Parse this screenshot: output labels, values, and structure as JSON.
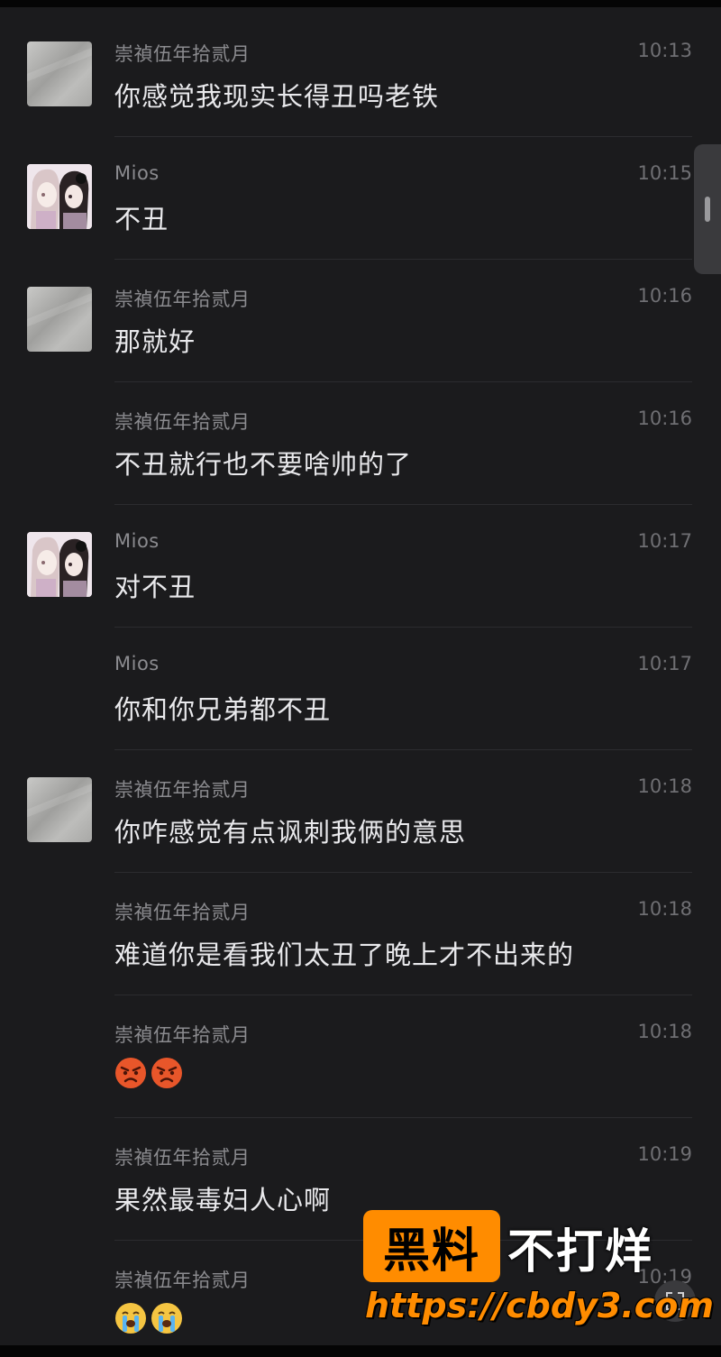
{
  "colors": {
    "background": "#1b1b1d",
    "name_text": "#8b8b8f",
    "time_text": "#6f6f73",
    "message_text": "#e9e9ec",
    "divider": "#2c2c2f",
    "watermark_accent": "#ff8c00"
  },
  "messages": [
    {
      "sender": "崇禎伍年拾贰月",
      "time": "10:13",
      "text": "你感觉我现实长得丑吗老铁",
      "avatar": "gray-avatar"
    },
    {
      "sender": "Mios",
      "time": "10:15",
      "text": "不丑",
      "avatar": "anime-girl-avatar"
    },
    {
      "sender": "崇禎伍年拾贰月",
      "time": "10:16",
      "text": "那就好",
      "avatar": "gray-avatar"
    },
    {
      "sender": "崇禎伍年拾贰月",
      "time": "10:16",
      "text": "不丑就行也不要啥帅的了"
    },
    {
      "sender": "Mios",
      "time": "10:17",
      "text": "对不丑",
      "avatar": "anime-girl-avatar"
    },
    {
      "sender": "Mios",
      "time": "10:17",
      "text": "你和你兄弟都不丑"
    },
    {
      "sender": "崇禎伍年拾贰月",
      "time": "10:18",
      "text": "你咋感觉有点讽刺我俩的意思",
      "avatar": "gray-avatar"
    },
    {
      "sender": "崇禎伍年拾贰月",
      "time": "10:18",
      "text": "难道你是看我们太丑了晚上才不出来的"
    },
    {
      "sender": "崇禎伍年拾贰月",
      "time": "10:18",
      "emojis": [
        "angry-face-icon",
        "angry-face-icon"
      ]
    },
    {
      "sender": "崇禎伍年拾贰月",
      "time": "10:19",
      "text": "果然最毒妇人心啊"
    },
    {
      "sender": "崇禎伍年拾贰月",
      "time": "10:19",
      "emojis": [
        "crying-face-icon",
        "crying-face-icon"
      ]
    }
  ],
  "watermark": {
    "box_text": "黑料",
    "side_text": "不打烊",
    "url": "https://cbdy3.com"
  }
}
